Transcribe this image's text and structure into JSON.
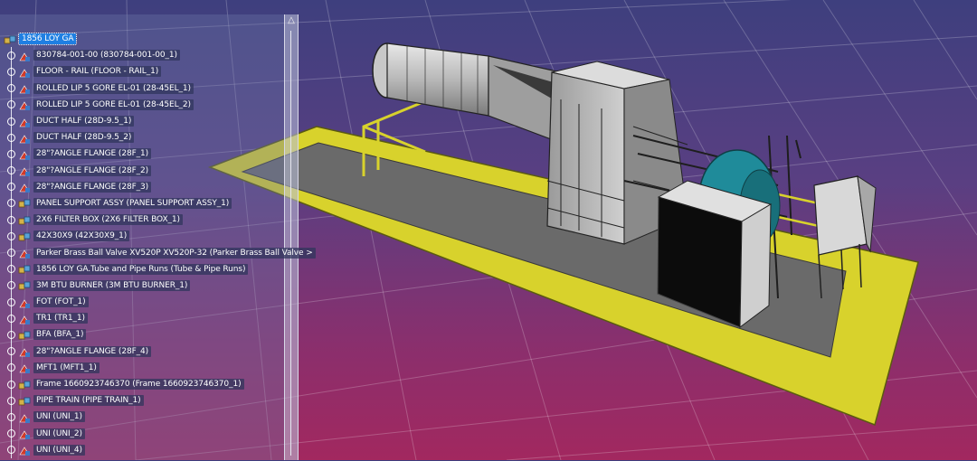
{
  "tree": {
    "root": {
      "label": "1856 LOY GA",
      "selected": true
    },
    "items": [
      {
        "label": "830784-001-00 (830784-001-00_1)",
        "icon": "part-icon"
      },
      {
        "label": "FLOOR - RAIL (FLOOR - RAIL_1)",
        "icon": "part-icon"
      },
      {
        "label": "ROLLED LIP 5 GORE EL-01 (28-45EL_1)",
        "icon": "part-icon"
      },
      {
        "label": "ROLLED LIP 5 GORE EL-01 (28-45EL_2)",
        "icon": "part-icon"
      },
      {
        "label": "DUCT HALF (28D-9.5_1)",
        "icon": "part-icon"
      },
      {
        "label": "DUCT HALF (28D-9.5_2)",
        "icon": "part-icon"
      },
      {
        "label": "28\"?ANGLE FLANGE (28F_1)",
        "icon": "part-icon"
      },
      {
        "label": "28\"?ANGLE FLANGE (28F_2)",
        "icon": "part-icon"
      },
      {
        "label": "28\"?ANGLE FLANGE (28F_3)",
        "icon": "part-icon"
      },
      {
        "label": "PANEL SUPPORT ASSY (PANEL SUPPORT ASSY_1)",
        "icon": "product-icon"
      },
      {
        "label": "2X6 FILTER BOX (2X6 FILTER BOX_1)",
        "icon": "product-icon"
      },
      {
        "label": "42X30X9 (42X30X9_1)",
        "icon": "product-icon"
      },
      {
        "label": "Parker Brass Ball Valve XV520P XV520P-32 (Parker Brass Ball Valve >",
        "icon": "part-icon"
      },
      {
        "label": "1856 LOY GA.Tube and Pipe Runs (Tube & Pipe Runs)",
        "icon": "product-icon"
      },
      {
        "label": "3M BTU BURNER (3M BTU BURNER_1)",
        "icon": "product-icon"
      },
      {
        "label": "FOT (FOT_1)",
        "icon": "part-icon"
      },
      {
        "label": "TR1 (TR1_1)",
        "icon": "part-icon"
      },
      {
        "label": "BFA (BFA_1)",
        "icon": "product-icon"
      },
      {
        "label": "28\"?ANGLE FLANGE (28F_4)",
        "icon": "part-icon"
      },
      {
        "label": "MFT1 (MFT1_1)",
        "icon": "part-icon"
      },
      {
        "label": "Frame 1660923746370 (Frame 1660923746370_1)",
        "icon": "product-icon"
      },
      {
        "label": "PIPE TRAIN (PIPE TRAIN_1)",
        "icon": "product-icon"
      },
      {
        "label": "UNI (UNI_1)",
        "icon": "part-icon"
      },
      {
        "label": "UNI (UNI_2)",
        "icon": "part-icon"
      },
      {
        "label": "UNI (UNI_4)",
        "icon": "part-icon"
      }
    ]
  },
  "colors": {
    "selection": "#1f7fe2",
    "platform_yellow": "#d8d22c",
    "deck_gray": "#6a6a6a",
    "burner_teal": "#1f8b9a"
  }
}
